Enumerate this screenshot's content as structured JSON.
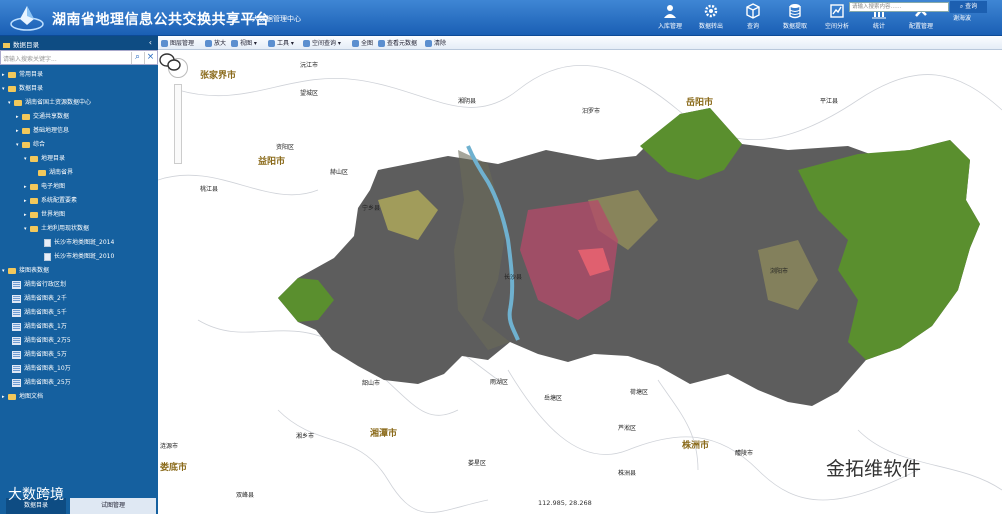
{
  "header": {
    "title": "湖南省地理信息公共交换共享平台",
    "subtitle": "大数据管理中心",
    "user": "谢海波",
    "nav": [
      {
        "label": "入库管理",
        "icon": "user-upload-icon"
      },
      {
        "label": "数据转出",
        "icon": "gear-icon"
      },
      {
        "label": "查询",
        "icon": "cube-icon"
      },
      {
        "label": "数据提取",
        "icon": "database-icon"
      },
      {
        "label": "空间分析",
        "icon": "analysis-icon"
      },
      {
        "label": "统计",
        "icon": "chart-icon"
      },
      {
        "label": "配置管理",
        "icon": "tools-icon"
      }
    ]
  },
  "sidebar": {
    "title": "数据目录",
    "search_placeholder": "请输入搜索关键字...",
    "tabs": [
      "数据目录",
      "试图管理"
    ],
    "tree": [
      "常用目录",
      "数据目录",
      "湖南省国土资源数据中心",
      "交通共享数据",
      "基础地理信息",
      "综合",
      "地理目录",
      "湖南省界",
      "电子地图",
      "系统配置要素",
      "世界地图",
      "土地利用现状数据",
      "长沙市地类图斑_2014",
      "长沙市地类图斑_2010",
      "接图表数据",
      "湖南省行政区划",
      "湖南省图表_2千",
      "湖南省图表_5千",
      "湖南省图表_1万",
      "湖南省图表_2万5",
      "湖南省图表_5万",
      "湖南省图表_10万",
      "湖南省图表_25万",
      "地图文档"
    ]
  },
  "toolbar": {
    "items": [
      "图层管理",
      "放大",
      "视图",
      "工具",
      "空间查询",
      "全图",
      "查看元数据",
      "清除"
    ],
    "search_placeholder": "请输入搜索内容……",
    "search_button": "查询"
  },
  "map": {
    "coords": "112.985, 28.268",
    "labels": [
      "张家界市",
      "益阳市",
      "岳阳市",
      "湘潭市",
      "株洲市",
      "娄底市",
      "长沙县",
      "望城区",
      "宁乡县",
      "沅江市",
      "湘阴县",
      "汨罗市",
      "平江县",
      "浏阳市",
      "桃江县",
      "赫山区",
      "资阳区",
      "韶山市",
      "湘乡市",
      "雨湖区",
      "岳塘区",
      "荷塘区",
      "芦淞区",
      "醴陵市",
      "株洲县",
      "双峰县",
      "涟源市",
      "娄星区"
    ]
  },
  "watermark": "金拓维软件",
  "badge": "大数跨境"
}
